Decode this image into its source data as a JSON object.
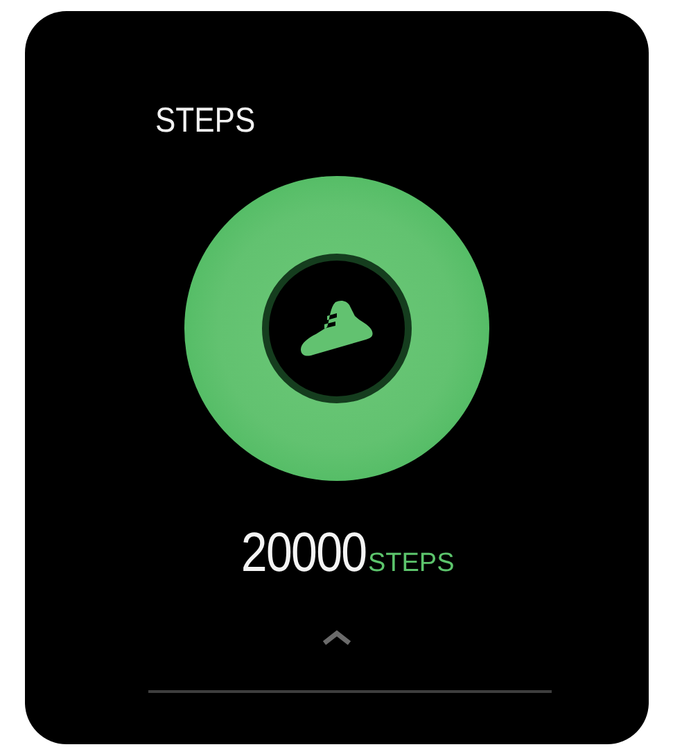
{
  "title": "STEPS",
  "reading": {
    "value": "20000",
    "unit": "STEPS"
  }
}
